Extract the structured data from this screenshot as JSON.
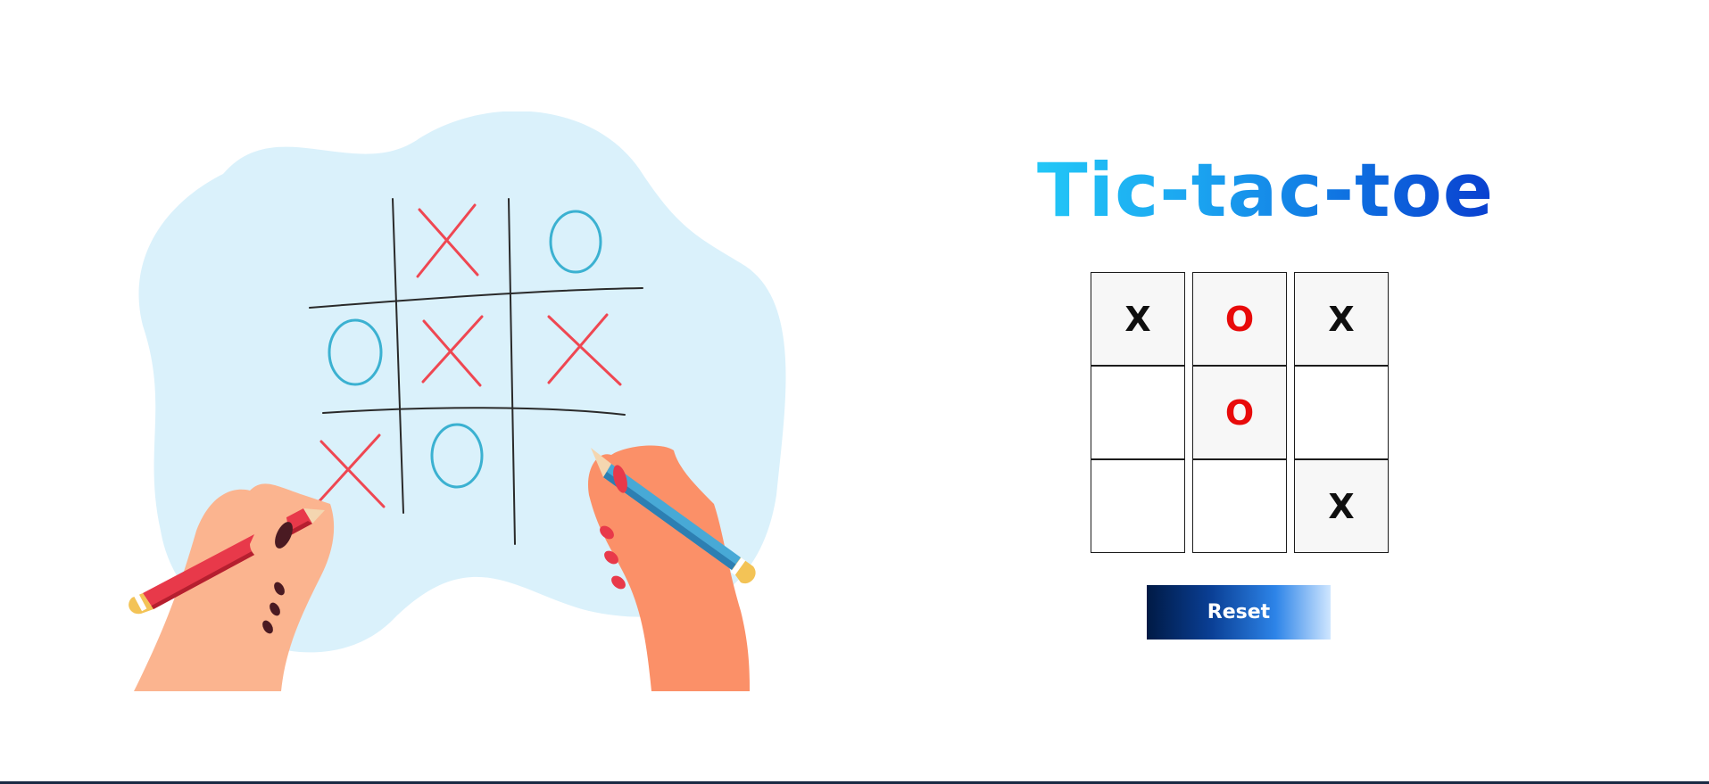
{
  "title": "Tic-tac-toe",
  "board": {
    "cells": [
      "X",
      "O",
      "X",
      "",
      "O",
      "",
      "",
      "",
      "X"
    ]
  },
  "reset_label": "Reset",
  "colors": {
    "x_mark": "#0f0f0f",
    "o_mark": "#e80a0a",
    "title_gradient_start": "#22c7f7",
    "title_gradient_end": "#0a3fcf",
    "reset_gradient_start": "#001a45",
    "reset_gradient_end": "#cfe6ff",
    "illustration_background": "#daf1fb"
  }
}
